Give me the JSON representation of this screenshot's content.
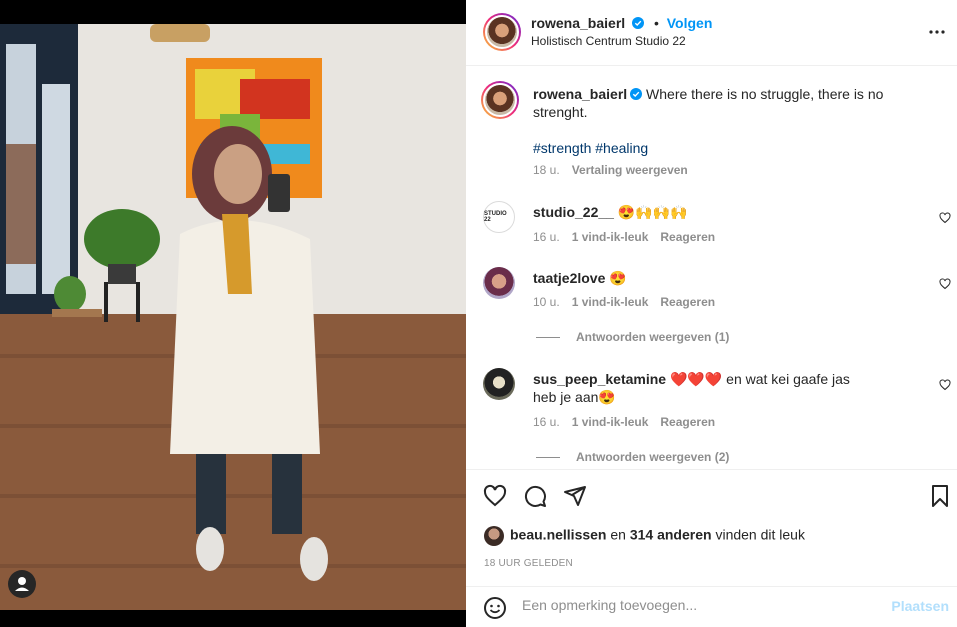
{
  "post": {
    "author": "rowena_baierl",
    "follow_label": "Volgen",
    "location": "Holistisch Centrum Studio 22",
    "separator": "•"
  },
  "caption": {
    "author": "rowena_baierl",
    "text": "Where there is no struggle, there is no strenght.",
    "hashtags": "#strength #healing",
    "time": "18 u.",
    "translate_label": "Vertaling weergeven"
  },
  "comments": [
    {
      "user": "studio_22__",
      "text": "😍🙌🙌🙌",
      "time": "16 u.",
      "likes": "1 vind-ik-leuk",
      "reply": "Reageren",
      "avatar_text": "STUDIO 22"
    },
    {
      "user": "taatje2love",
      "text": "😍",
      "time": "10 u.",
      "likes": "1 vind-ik-leuk",
      "reply": "Reageren",
      "view_replies": "Antwoorden weergeven (1)"
    },
    {
      "user": "sus_peep_ketamine",
      "text": "❤️❤️❤️ en wat kei gaafe jas heb je aan😍",
      "time": "16 u.",
      "likes": "1 vind-ik-leuk",
      "reply": "Reageren",
      "view_replies": "Antwoorden weergeven (2)"
    }
  ],
  "likes": {
    "user": "beau.nellissen",
    "middle": "en",
    "count": "314 anderen",
    "suffix": "vinden dit leuk"
  },
  "timestamp": "18 UUR GELEDEN",
  "composer": {
    "placeholder": "Een opmerking toevoegen...",
    "post_label": "Plaatsen"
  },
  "colors": {
    "accent": "#0095f6",
    "hashtag": "#00376b",
    "muted": "#8e8e8e",
    "post_disabled": "#b2dffc"
  },
  "icons": [
    "verified-badge-icon",
    "more-options-icon",
    "heart-icon",
    "comment-icon",
    "share-icon",
    "bookmark-icon",
    "emoji-icon",
    "user-tag-icon"
  ]
}
